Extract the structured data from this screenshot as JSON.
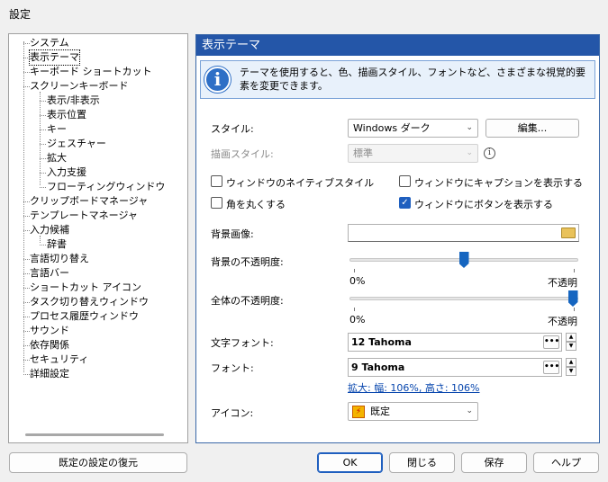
{
  "window": {
    "title": "設定"
  },
  "tree": {
    "items": [
      {
        "label": "システム",
        "level": 0,
        "selected": false
      },
      {
        "label": "表示テーマ",
        "level": 0,
        "selected": true
      },
      {
        "label": "キーボード ショートカット",
        "level": 0,
        "selected": false
      },
      {
        "label": "スクリーンキーボード",
        "level": 0,
        "selected": false
      },
      {
        "label": "表示/非表示",
        "level": 1,
        "selected": false
      },
      {
        "label": "表示位置",
        "level": 1,
        "selected": false
      },
      {
        "label": "キー",
        "level": 1,
        "selected": false
      },
      {
        "label": "ジェスチャー",
        "level": 1,
        "selected": false
      },
      {
        "label": "拡大",
        "level": 1,
        "selected": false
      },
      {
        "label": "入力支援",
        "level": 1,
        "selected": false
      },
      {
        "label": "フローティングウィンドウ",
        "level": 1,
        "selected": false
      },
      {
        "label": "クリップボードマネージャ",
        "level": 0,
        "selected": false
      },
      {
        "label": "テンプレートマネージャ",
        "level": 0,
        "selected": false
      },
      {
        "label": "入力候補",
        "level": 0,
        "selected": false
      },
      {
        "label": "辞書",
        "level": 1,
        "selected": false
      },
      {
        "label": "言語切り替え",
        "level": 0,
        "selected": false
      },
      {
        "label": "言語バー",
        "level": 0,
        "selected": false
      },
      {
        "label": "ショートカット アイコン",
        "level": 0,
        "selected": false
      },
      {
        "label": "タスク切り替えウィンドウ",
        "level": 0,
        "selected": false
      },
      {
        "label": "プロセス履歴ウィンドウ",
        "level": 0,
        "selected": false
      },
      {
        "label": "サウンド",
        "level": 0,
        "selected": false
      },
      {
        "label": "依存関係",
        "level": 0,
        "selected": false
      },
      {
        "label": "セキュリティ",
        "level": 0,
        "selected": false
      },
      {
        "label": "詳細設定",
        "level": 0,
        "selected": false
      }
    ]
  },
  "panel": {
    "title": "表示テーマ",
    "info": "テーマを使用すると、色、描画スタイル、フォントなど、さまざまな視覚的要素を変更できます。",
    "style_label": "スタイル:",
    "style_value": "Windows ダーク",
    "edit_button": "編集...",
    "draw_style_label": "描画スタイル:",
    "draw_style_value": "標準",
    "checkboxes": {
      "native_style": {
        "label": "ウィンドウのネイティブスタイル",
        "checked": false
      },
      "show_caption": {
        "label": "ウィンドウにキャプションを表示する",
        "checked": false
      },
      "round_corners": {
        "label": "角を丸くする",
        "checked": false
      },
      "show_buttons": {
        "label": "ウィンドウにボタンを表示する",
        "checked": true
      }
    },
    "bg_image_label": "背景画像:",
    "bg_image_value": "",
    "bg_opacity": {
      "label": "背景の不透明度:",
      "min_label": "0%",
      "max_label": "不透明",
      "value_percent": 50
    },
    "total_opacity": {
      "label": "全体の不透明度:",
      "min_label": "0%",
      "max_label": "不透明",
      "value_percent": 100
    },
    "text_font_label": "文字フォント:",
    "text_font_value": "12 Tahoma",
    "font_label": "フォント:",
    "font_value": "9 Tahoma",
    "zoom_link": "拡大: 幅: 106%, 高さ: 106%",
    "icon_label": "アイコン:",
    "icon_value": "既定"
  },
  "footer": {
    "restore": "既定の設定の復元",
    "ok": "OK",
    "close": "閉じる",
    "save": "保存",
    "help": "ヘルプ"
  },
  "colors": {
    "accent": "#2456a8",
    "checkbox": "#1f5fbf",
    "slider": "#1565c0",
    "link": "#0645ad"
  }
}
